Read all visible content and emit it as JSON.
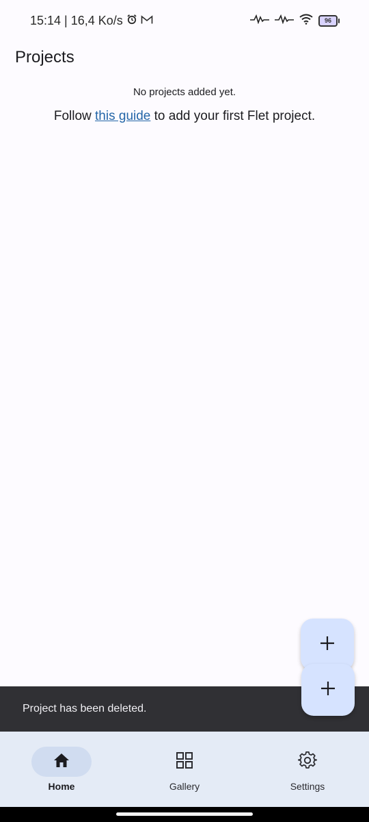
{
  "status_bar": {
    "time": "15:14",
    "separator": "|",
    "network_speed": "16,4 Ko/s",
    "battery_level": "96",
    "icons": [
      "alarm-icon",
      "gmail-icon",
      "signal-icon",
      "signal-icon",
      "wifi-icon",
      "battery-icon"
    ]
  },
  "header": {
    "title": "Projects"
  },
  "empty_state": {
    "message": "No projects added yet.",
    "guide_prefix": "Follow ",
    "guide_link": "this guide",
    "guide_suffix": " to add your first Flet project."
  },
  "fabs": [
    {
      "icon": "plus-icon"
    },
    {
      "icon": "plus-icon"
    }
  ],
  "snackbar": {
    "text": "Project has been deleted."
  },
  "nav": {
    "items": [
      {
        "label": "Home",
        "icon": "home-icon",
        "active": true
      },
      {
        "label": "Gallery",
        "icon": "grid-icon",
        "active": false
      },
      {
        "label": "Settings",
        "icon": "gear-icon",
        "active": false
      }
    ]
  },
  "colors": {
    "background": "#fdfbff",
    "fab": "#d6e3ff",
    "snackbar": "#303034",
    "navbar": "#e4ebf6",
    "nav_active_pill": "#d0dcf0",
    "link": "#2466a8"
  }
}
